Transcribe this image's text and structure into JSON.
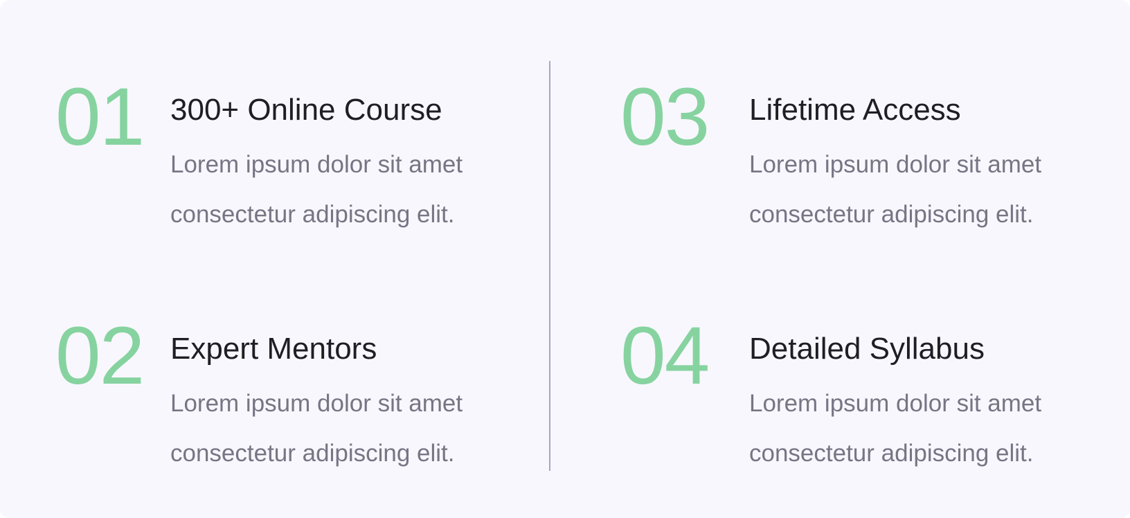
{
  "features": [
    {
      "number": "01",
      "title": "300+ Online Course",
      "desc_line1": "Lorem ipsum dolor sit amet",
      "desc_line2": "consectetur adipiscing elit."
    },
    {
      "number": "02",
      "title": "Expert Mentors",
      "desc_line1": "Lorem ipsum dolor sit amet",
      "desc_line2": "consectetur adipiscing elit."
    },
    {
      "number": "03",
      "title": "Lifetime Access",
      "desc_line1": "Lorem ipsum dolor sit amet",
      "desc_line2": "consectetur adipiscing elit."
    },
    {
      "number": "04",
      "title": "Detailed Syllabus",
      "desc_line1": "Lorem ipsum dolor sit amet",
      "desc_line2": "consectetur adipiscing elit."
    }
  ],
  "colors": {
    "background": "#f8f7fd",
    "number": "#86d3a0",
    "title": "#1e1e24",
    "description": "#777584",
    "divider": "#a8a6c6"
  }
}
